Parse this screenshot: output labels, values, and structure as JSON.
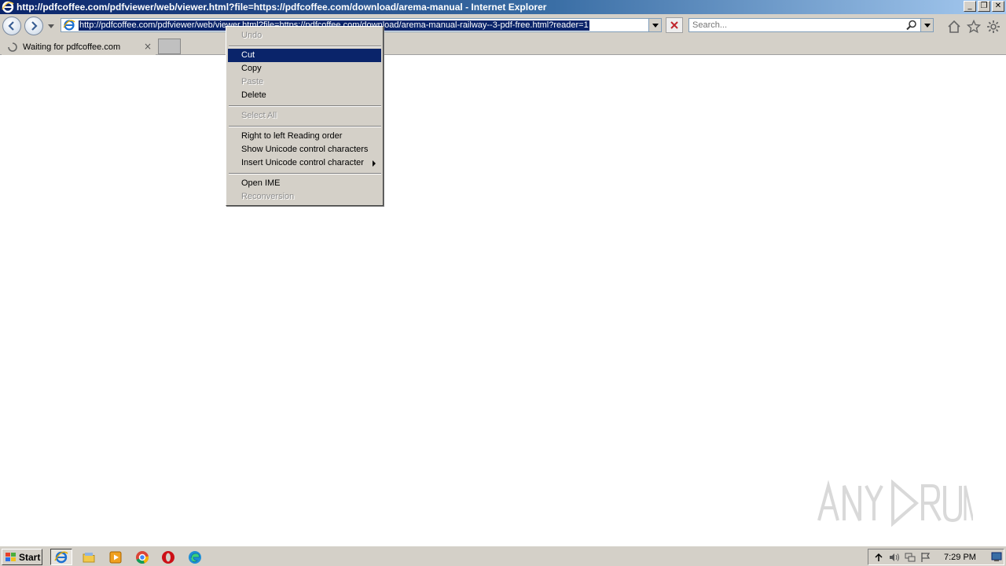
{
  "window": {
    "title": "http://pdfcoffee.com/pdfviewer/web/viewer.html?file=https://pdfcoffee.com/download/arema-manual - Internet Explorer",
    "controls": {
      "minimize": "_",
      "restore": "❐",
      "close": "✕"
    }
  },
  "address_bar": {
    "url": "http://pdfcoffee.com/pdfviewer/web/viewer.html?file=https://pdfcoffee.com/download/arema-manual-railway--3-pdf-free.html?reader=1"
  },
  "search_box": {
    "placeholder": "Search..."
  },
  "tabs": [
    {
      "label": "Waiting for pdfcoffee.com",
      "close": "×"
    }
  ],
  "context_menu": {
    "items": [
      {
        "label": "Undo",
        "enabled": false
      },
      {
        "label": "Cut",
        "enabled": true,
        "highlighted": true
      },
      {
        "label": "Copy",
        "enabled": true
      },
      {
        "label": "Paste",
        "enabled": false
      },
      {
        "label": "Delete",
        "enabled": true
      },
      {
        "label": "Select All",
        "enabled": false
      },
      {
        "label": "Right to left Reading order",
        "enabled": true
      },
      {
        "label": "Show Unicode control characters",
        "enabled": true
      },
      {
        "label": "Insert Unicode control character",
        "enabled": true,
        "submenu": true
      },
      {
        "label": "Open IME",
        "enabled": true
      },
      {
        "label": "Reconversion",
        "enabled": false
      }
    ]
  },
  "taskbar": {
    "start_label": "Start",
    "apps": [
      "internet-explorer-icon",
      "file-explorer-icon",
      "media-player-icon",
      "chrome-icon",
      "opera-icon",
      "edge-icon"
    ],
    "clock": "7:29 PM"
  },
  "colors": {
    "menu_highlight": "#0a246a",
    "chrome_bg": "#d4d0c8",
    "title_gradient_start": "#0a246a",
    "title_gradient_end": "#a6caf0"
  }
}
